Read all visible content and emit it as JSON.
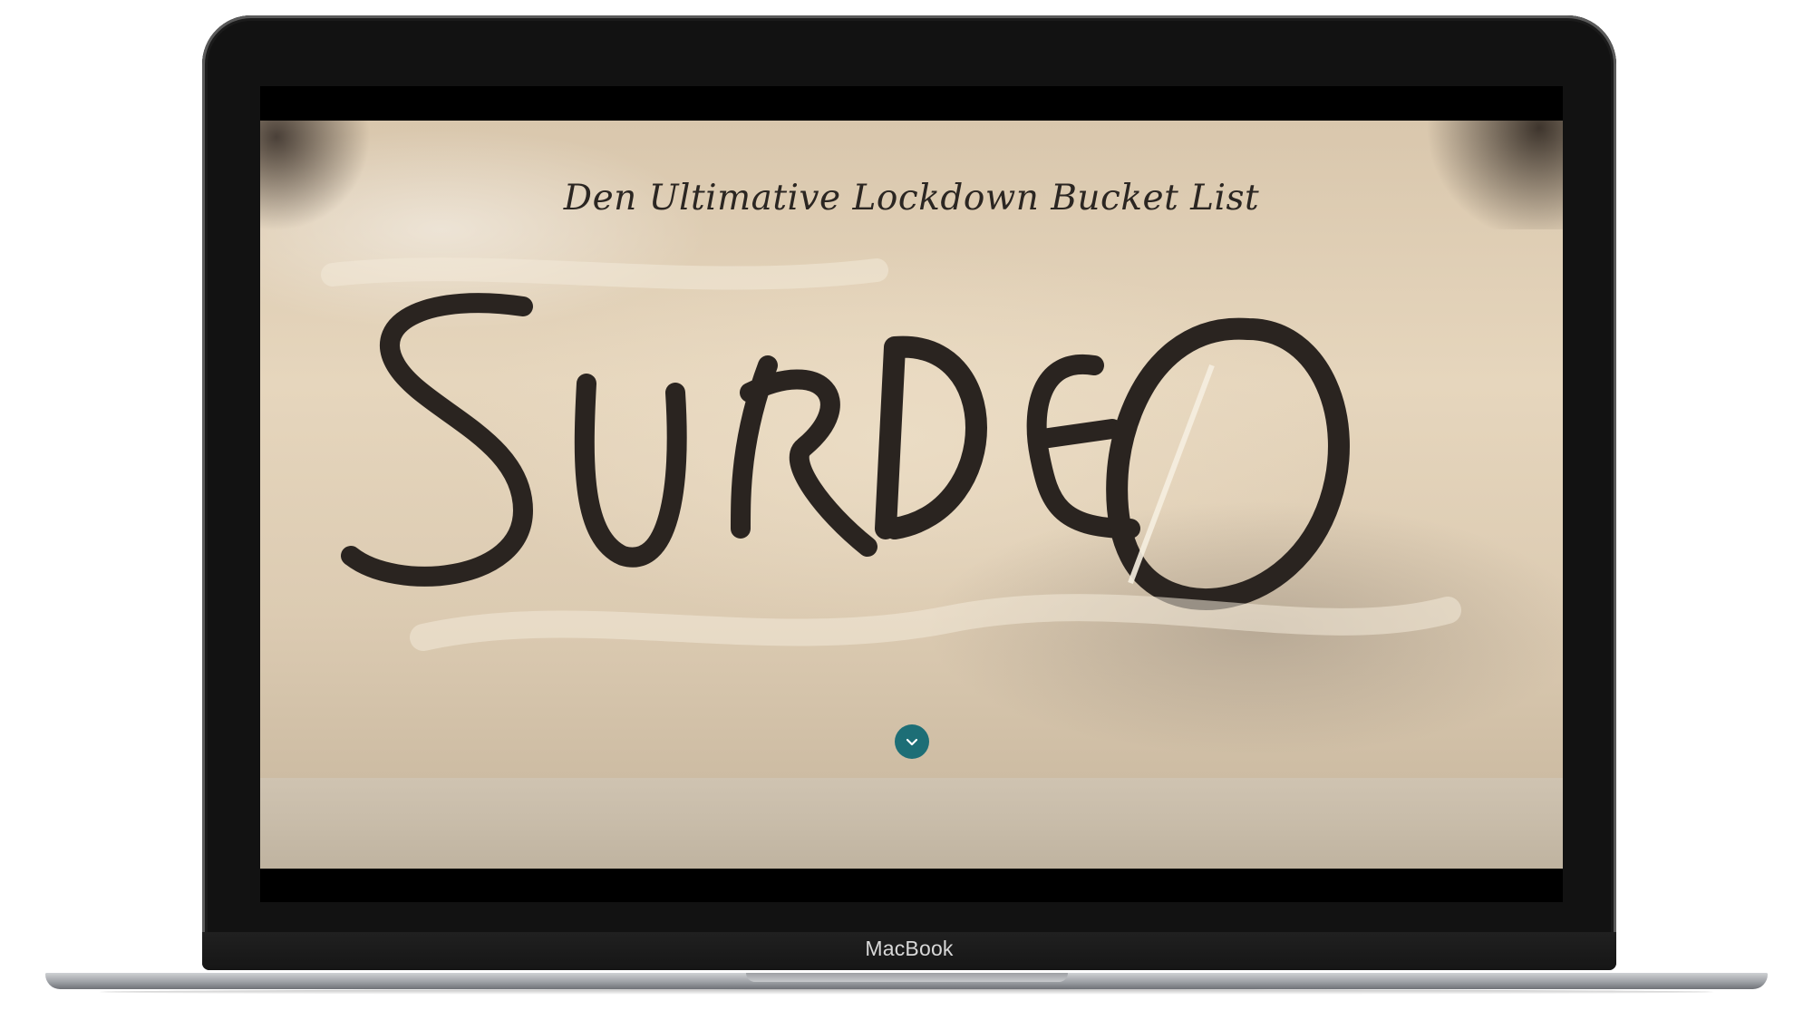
{
  "device": {
    "brand_label": "MacBook"
  },
  "page": {
    "hero_title": "Den Ultimative Lockdown Bucket List",
    "hero_image_text": "SURDEJ",
    "scroll_button_icon": "chevron-down-icon"
  },
  "colors": {
    "accent": "#1d6e76",
    "title_text": "#2b2622",
    "flour_background": "#e6d6bd"
  }
}
